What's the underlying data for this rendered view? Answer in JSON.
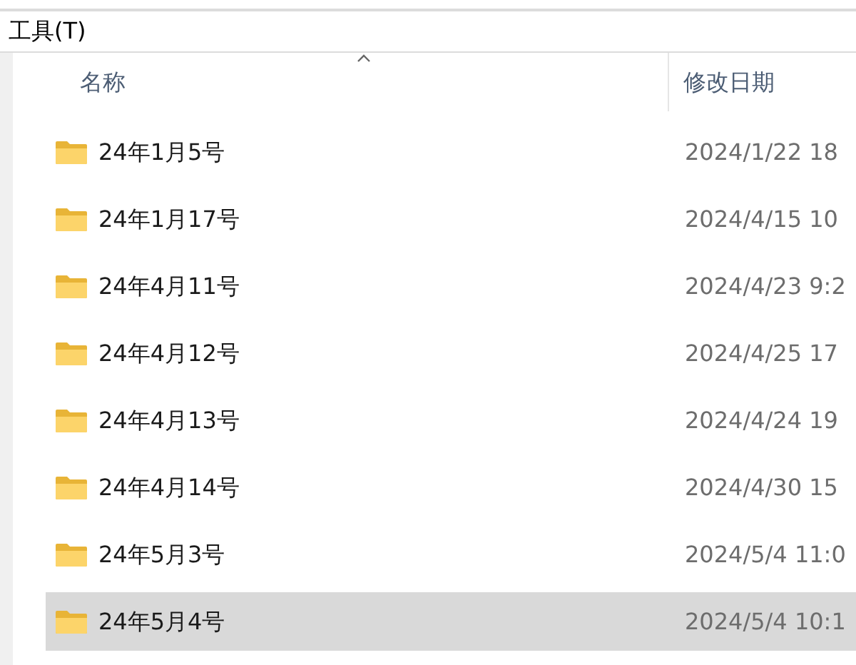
{
  "menu_bar": {
    "items": [
      "工具(T)"
    ]
  },
  "columns": [
    {
      "label": "名称",
      "sorted": true
    },
    {
      "label": "修改日期",
      "sorted": false
    }
  ],
  "rows": [
    {
      "name": "24年1月5号",
      "modified": "2024/1/22 18",
      "selected": false
    },
    {
      "name": "24年1月17号",
      "modified": "2024/4/15 10",
      "selected": false
    },
    {
      "name": "24年4月11号",
      "modified": "2024/4/23 9:2",
      "selected": false
    },
    {
      "name": "24年4月12号",
      "modified": "2024/4/25 17",
      "selected": false
    },
    {
      "name": "24年4月13号",
      "modified": "2024/4/24 19",
      "selected": false
    },
    {
      "name": "24年4月14号",
      "modified": "2024/4/30 15",
      "selected": false
    },
    {
      "name": "24年5月3号",
      "modified": "2024/5/4 11:0",
      "selected": false
    },
    {
      "name": "24年5月4号",
      "modified": "2024/5/4 10:1",
      "selected": true
    }
  ]
}
